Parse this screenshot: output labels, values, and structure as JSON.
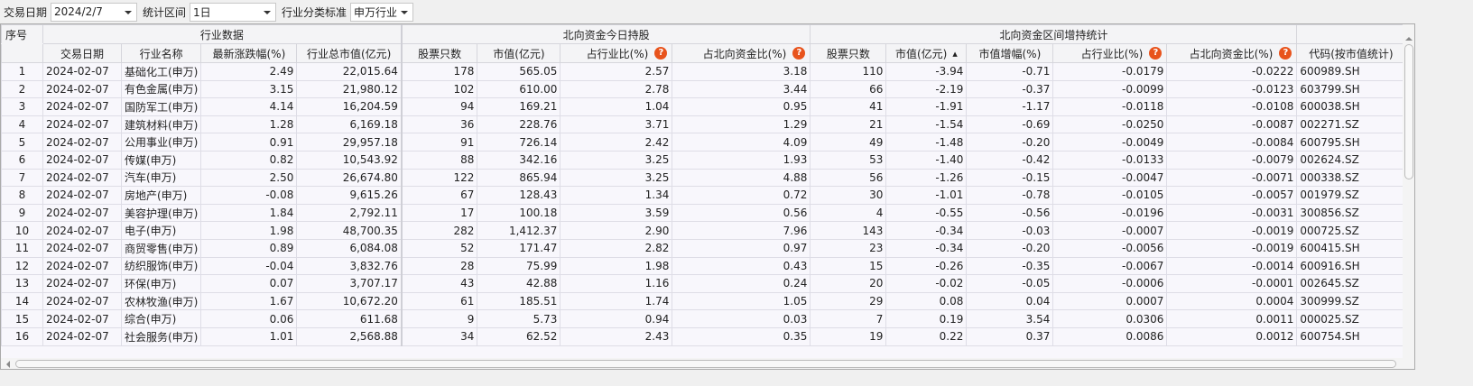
{
  "toolbar": {
    "date_label": "交易日期",
    "date_value": "2024/2/7",
    "period_label": "统计区间",
    "period_value": "1日",
    "standard_label": "行业分类标准",
    "standard_value": "申万行业"
  },
  "groups": {
    "index": "序号",
    "industry": "行业数据",
    "today": "北向资金今日持股",
    "interval": "北向资金区间增持统计"
  },
  "columns": [
    "交易日期",
    "行业名称",
    "最新涨跌幅(%)",
    "行业总市值(亿元)",
    "股票只数",
    "市值(亿元)",
    "占行业比(%)",
    "占北向资金比(%)",
    "股票只数",
    "市值(亿元)",
    "市值增幅(%)",
    "占行业比(%)",
    "占北向资金比(%)",
    "代码(按市值统计)"
  ],
  "help_icon": "?",
  "rows": [
    [
      "1",
      "2024-02-07",
      "基础化工(申万)",
      "2.49",
      "22,015.64",
      "178",
      "565.05",
      "2.57",
      "3.18",
      "110",
      "-3.94",
      "-0.71",
      "-0.0179",
      "-0.0222",
      "600989.SH"
    ],
    [
      "2",
      "2024-02-07",
      "有色金属(申万)",
      "3.15",
      "21,980.12",
      "102",
      "610.00",
      "2.78",
      "3.44",
      "66",
      "-2.19",
      "-0.37",
      "-0.0099",
      "-0.0123",
      "603799.SH"
    ],
    [
      "3",
      "2024-02-07",
      "国防军工(申万)",
      "4.14",
      "16,204.59",
      "94",
      "169.21",
      "1.04",
      "0.95",
      "41",
      "-1.91",
      "-1.17",
      "-0.0118",
      "-0.0108",
      "600038.SH"
    ],
    [
      "4",
      "2024-02-07",
      "建筑材料(申万)",
      "1.28",
      "6,169.18",
      "36",
      "228.76",
      "3.71",
      "1.29",
      "21",
      "-1.54",
      "-0.69",
      "-0.0250",
      "-0.0087",
      "002271.SZ"
    ],
    [
      "5",
      "2024-02-07",
      "公用事业(申万)",
      "0.91",
      "29,957.18",
      "91",
      "726.14",
      "2.42",
      "4.09",
      "49",
      "-1.48",
      "-0.20",
      "-0.0049",
      "-0.0084",
      "600795.SH"
    ],
    [
      "6",
      "2024-02-07",
      "传媒(申万)",
      "0.82",
      "10,543.92",
      "88",
      "342.16",
      "3.25",
      "1.93",
      "53",
      "-1.40",
      "-0.42",
      "-0.0133",
      "-0.0079",
      "002624.SZ"
    ],
    [
      "7",
      "2024-02-07",
      "汽车(申万)",
      "2.50",
      "26,674.80",
      "122",
      "865.94",
      "3.25",
      "4.88",
      "56",
      "-1.26",
      "-0.15",
      "-0.0047",
      "-0.0071",
      "000338.SZ"
    ],
    [
      "8",
      "2024-02-07",
      "房地产(申万)",
      "-0.08",
      "9,615.26",
      "67",
      "128.43",
      "1.34",
      "0.72",
      "30",
      "-1.01",
      "-0.78",
      "-0.0105",
      "-0.0057",
      "001979.SZ"
    ],
    [
      "9",
      "2024-02-07",
      "美容护理(申万)",
      "1.84",
      "2,792.11",
      "17",
      "100.18",
      "3.59",
      "0.56",
      "4",
      "-0.55",
      "-0.56",
      "-0.0196",
      "-0.0031",
      "300856.SZ"
    ],
    [
      "10",
      "2024-02-07",
      "电子(申万)",
      "1.98",
      "48,700.35",
      "282",
      "1,412.37",
      "2.90",
      "7.96",
      "143",
      "-0.34",
      "-0.03",
      "-0.0007",
      "-0.0019",
      "000725.SZ"
    ],
    [
      "11",
      "2024-02-07",
      "商贸零售(申万)",
      "0.89",
      "6,084.08",
      "52",
      "171.47",
      "2.82",
      "0.97",
      "23",
      "-0.34",
      "-0.20",
      "-0.0056",
      "-0.0019",
      "600415.SH"
    ],
    [
      "12",
      "2024-02-07",
      "纺织服饰(申万)",
      "-0.04",
      "3,832.76",
      "28",
      "75.99",
      "1.98",
      "0.43",
      "15",
      "-0.26",
      "-0.35",
      "-0.0067",
      "-0.0014",
      "600916.SH"
    ],
    [
      "13",
      "2024-02-07",
      "环保(申万)",
      "0.07",
      "3,707.17",
      "43",
      "42.88",
      "1.16",
      "0.24",
      "20",
      "-0.02",
      "-0.05",
      "-0.0006",
      "-0.0001",
      "002645.SZ"
    ],
    [
      "14",
      "2024-02-07",
      "农林牧渔(申万)",
      "1.67",
      "10,672.20",
      "61",
      "185.51",
      "1.74",
      "1.05",
      "29",
      "0.08",
      "0.04",
      "0.0007",
      "0.0004",
      "300999.SZ"
    ],
    [
      "15",
      "2024-02-07",
      "综合(申万)",
      "0.06",
      "611.68",
      "9",
      "5.73",
      "0.94",
      "0.03",
      "7",
      "0.19",
      "3.54",
      "0.0306",
      "0.0011",
      "000025.SZ"
    ],
    [
      "16",
      "2024-02-07",
      "社会服务(申万)",
      "1.01",
      "2,568.88",
      "34",
      "62.52",
      "2.43",
      "0.35",
      "19",
      "0.22",
      "0.37",
      "0.0086",
      "0.0012",
      "600754.SH"
    ]
  ]
}
